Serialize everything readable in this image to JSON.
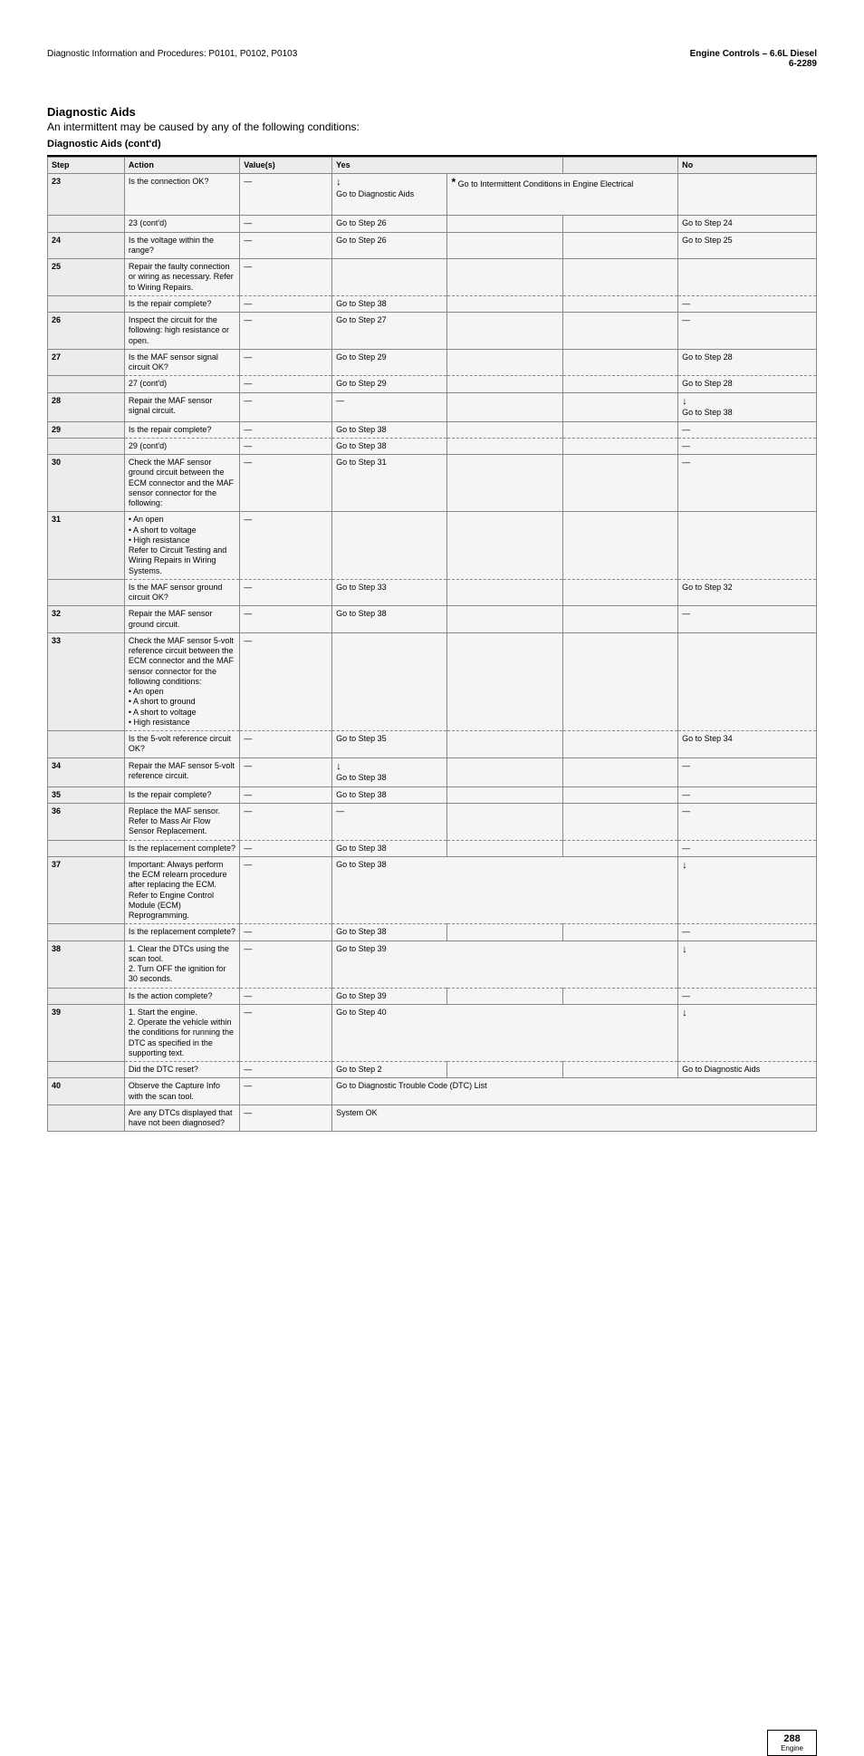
{
  "header": {
    "running_title": "Diagnostic Information and Procedures: P0101, P0102, P0103",
    "section_title": "Engine Controls – 6.6L Diesel",
    "section_page": "6-2289",
    "dm_title": "Diagnostic Aids",
    "dm_sub1": "An intermittent may be caused by any of the following conditions:",
    "dm_sub_cont": "Diagnostic Aids (cont'd)",
    "cont_label": " (cont'd)"
  },
  "table_header": {
    "step": "Step",
    "action": "Action",
    "values": "Value(s)",
    "yes": "Yes",
    "no": "No"
  },
  "rows": [
    {
      "step": "23",
      "action": "Is the connection OK?",
      "values": "—",
      "yes_arrow": true,
      "yes_text": "Go to Diagnostic Aids",
      "no_asterisk": true,
      "no_text": "* Go to Intermittent Conditions in Engine Electrical",
      "no_span": 2,
      "cont_action": "23 (cont'd)",
      "cont_values": "—",
      "cont_yes": "Go to Step 26",
      "cont_no": "Go to Step 24",
      "shade": true
    },
    {
      "step": "24",
      "action": "Is the voltage within the range?",
      "values": "—",
      "yes": "Go to Step 26",
      "no": "Go to Step 25"
    },
    {
      "step": "25",
      "action": "Repair the faulty connection or wiring as necessary. Refer to Wiring Repairs.",
      "values": "—",
      "cont_action": "Is the repair complete?",
      "cont_values": "—",
      "cont_yes": "Go to Step 38",
      "cont_no": "—",
      "shade": true,
      "dashed": true
    },
    {
      "step": "26",
      "action": "Inspect the circuit for the following: high resistance or open.",
      "values": "—",
      "yes": "Go to Step 27",
      "no": "—"
    },
    {
      "step": "27",
      "action": "Is the MAF sensor signal circuit OK?",
      "values": "—",
      "yes": "Go to Step 29",
      "no": "Go to Step 28",
      "cont_action": "27 (cont'd)",
      "cont_values": "—",
      "cont_yes": "Go to Step 29",
      "cont_no": "Go to Step 28",
      "dashed": true
    },
    {
      "step": "28",
      "action": "Repair the MAF sensor signal circuit.",
      "values": "—",
      "yes": "—",
      "no_arrow": true,
      "no_text": "Go to Step 38"
    },
    {
      "step": "29",
      "action": "Is the repair complete?",
      "values": "—",
      "yes": "Go to Step 38",
      "no": "—",
      "cont_action": "29 (cont'd)",
      "cont_values": "—",
      "cont_yes": "Go to Step 38",
      "cont_no": "—",
      "dashed": true
    },
    {
      "step": "30",
      "action": "Check the MAF sensor ground circuit between the ECM connector and the MAF sensor connector for the following:",
      "values": "—",
      "yes": "Go to Step 31",
      "no": "—"
    },
    {
      "step": "31",
      "action": "• An open\n• A short to voltage\n• High resistance\nRefer to Circuit Testing and Wiring Repairs in Wiring Systems.",
      "values": "—",
      "cont_action": "Is the MAF sensor ground circuit OK?",
      "cont_values": "—",
      "cont_yes": "Go to Step 33",
      "cont_no": "Go to Step 32",
      "dashed": true,
      "shade": true,
      "tall": true
    },
    {
      "step": "32",
      "action": "Repair the MAF sensor ground circuit.",
      "values": "—",
      "yes": "Go to Step 38",
      "no": "—"
    },
    {
      "step": "33",
      "action": "Check the MAF sensor 5-volt reference circuit between the ECM connector and the MAF sensor connector for the following conditions:\n• An open\n• A short to ground\n• A short to voltage\n• High resistance",
      "values": "—",
      "cont_action": "Is the 5-volt reference circuit OK?",
      "cont_values": "—",
      "cont_yes": "Go to Step 35",
      "cont_no": "Go to Step 34",
      "dashed": true,
      "shade": true,
      "tall": true
    },
    {
      "step": "34",
      "action": "Repair the MAF sensor 5-volt reference circuit.",
      "values": "—",
      "yes_arrow": true,
      "yes_text": "Go to Step 38",
      "no": "—"
    },
    {
      "step": "35",
      "action": "Is the repair complete?",
      "values": "—",
      "yes": "Go to Step 38",
      "no": "—"
    },
    {
      "step": "36",
      "action": "Replace the MAF sensor. Refer to Mass Air Flow Sensor Replacement.",
      "values": "—",
      "yes": "—",
      "no": "—",
      "cont_action": "Is the replacement complete?",
      "cont_values": "—",
      "cont_yes": "Go to Step 38",
      "cont_no": "—",
      "dashed": true
    },
    {
      "step": "37",
      "action": "Important: Always perform the ECM relearn procedure after replacing the ECM. Refer to Engine Control Module (ECM) Reprogramming.",
      "values": "—",
      "yes_span_all": true,
      "yes_arrow": true,
      "yes_text": "Go to Step 38",
      "cont_action": "Is the replacement complete?",
      "cont_values": "—",
      "cont_yes": "Go to Step 38",
      "cont_no": "—",
      "dashed": true
    },
    {
      "step": "38",
      "action": "1. Clear the DTCs using the scan tool.\n2. Turn OFF the ignition for 30 seconds.",
      "values": "—",
      "yes_span_all": true,
      "yes_arrow": true,
      "yes_text": "Go to Step 39",
      "cont_action": "Is the action complete?",
      "cont_values": "—",
      "cont_yes": "Go to Step 39",
      "cont_no": "—",
      "dashed": true
    },
    {
      "step": "39",
      "action": "1. Start the engine.\n2. Operate the vehicle within the conditions for running the DTC as specified in the supporting text.",
      "values": "—",
      "yes_span_all": true,
      "yes_arrow": true,
      "yes_text": "Go to Step 40",
      "cont_action": "Did the DTC reset?",
      "cont_values": "—",
      "cont_yes": "Go to Step 2",
      "cont_no": "Go to Diagnostic Aids",
      "dashed": true
    },
    {
      "step": "40",
      "action": "Observe the Capture Info with the scan tool.",
      "values": "—",
      "yes_span_full": true,
      "yes_text": "Go to Diagnostic Trouble Code (DTC) List"
    },
    {
      "step": "",
      "action": "Are any DTCs displayed that have not been diagnosed?",
      "values": "—",
      "yes_span_full": true,
      "yes_text": "System OK"
    }
  ],
  "page_number": "288",
  "page_label": "Engine"
}
